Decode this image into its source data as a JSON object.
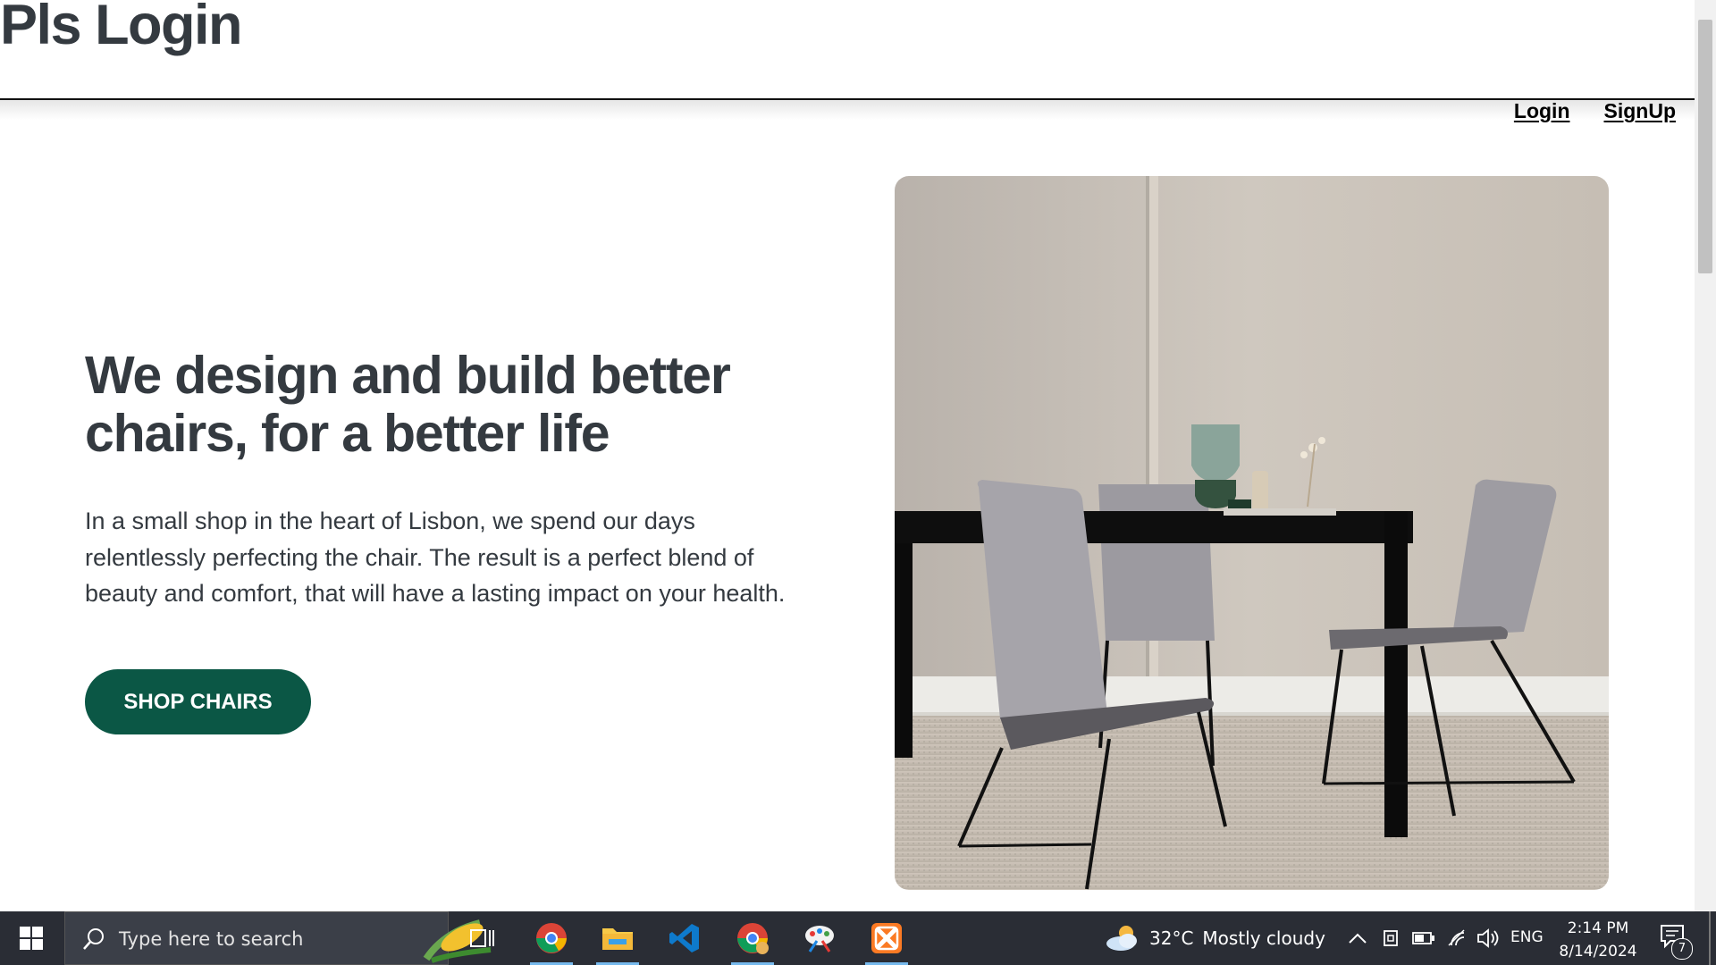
{
  "site": {
    "title": "Pls Login"
  },
  "nav": {
    "login_label": "Login",
    "signup_label": "SignUp"
  },
  "hero": {
    "heading": "We design and build better chairs, for a better life",
    "text": "In a small shop in the heart of Lisbon, we spend our days relentlessly perfecting the chair. The result is a perfect blend of beauty and comfort, that will have a lasting impact on your health.",
    "cta_label": "SHOP CHAIRS",
    "image_icon": "dining-chairs-photo"
  },
  "taskbar": {
    "search_placeholder": "Type here to search",
    "apps": [
      "chrome-icon",
      "file-explorer-icon",
      "vscode-icon",
      "chrome-profile-icon",
      "paint-icon",
      "xampp-icon"
    ],
    "weather": {
      "temp": "32°C",
      "condition": "Mostly cloudy"
    },
    "language": "ENG",
    "time": "2:14 PM",
    "date": "8/14/2024",
    "notification_count": "7"
  },
  "colors": {
    "accent": "#0b5745",
    "text": "#343a40",
    "taskbar": "#2a2d35"
  }
}
